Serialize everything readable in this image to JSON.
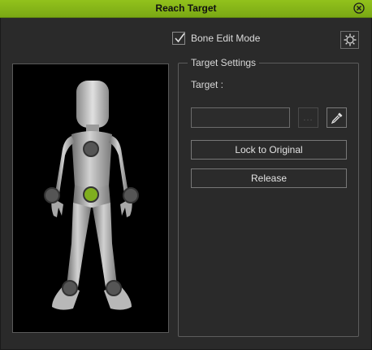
{
  "window": {
    "title": "Reach Target",
    "close_icon": "close-circle-icon"
  },
  "toolbar": {
    "bone_edit_label": "Bone Edit Mode",
    "bone_edit_checked": true,
    "settings_icon": "gear-icon"
  },
  "target_settings": {
    "legend": "Target Settings",
    "target_label": "Target :",
    "target_value": "",
    "browse_label": "...",
    "picker_icon": "eyedropper-icon",
    "lock_label": "Lock to Original",
    "release_label": "Release"
  },
  "colors": {
    "title_bar": "#86b818",
    "active_bone": "#7fae1e",
    "inactive_bone": "#555555",
    "panel_bg": "#2a2a2a"
  }
}
